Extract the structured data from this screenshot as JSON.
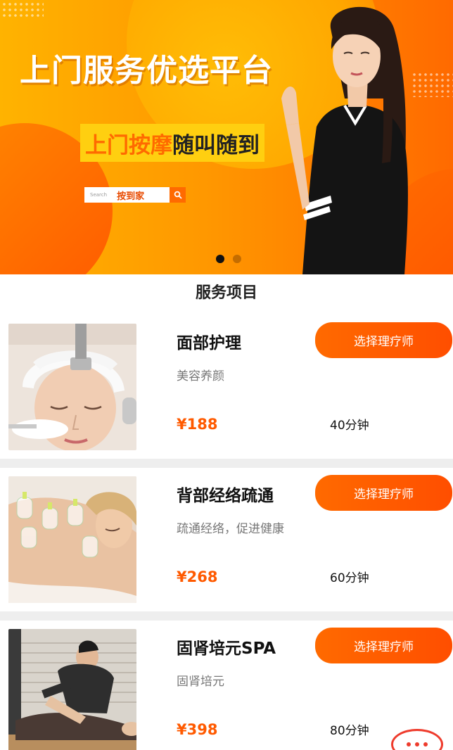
{
  "banner": {
    "title": "上门服务优选平台",
    "slogan_highlight": "上门按摩",
    "slogan_rest": "随叫随到",
    "search_placeholder": "Search",
    "search_brand": "按到家",
    "pager_total": 2,
    "pager_active": 1,
    "accent_color": "#ff6a00"
  },
  "section": {
    "title": "服务项目"
  },
  "services": [
    {
      "name": "面部护理",
      "desc": "美容养颜",
      "price": "¥188",
      "duration": "40分钟",
      "button": "选择理疗师",
      "image": "facial-treatment-photo"
    },
    {
      "name": "背部经络疏通",
      "desc": "疏通经络，促进健康",
      "price": "¥268",
      "duration": "60分钟",
      "button": "选择理疗师",
      "image": "back-cupping-photo"
    },
    {
      "name": "固肾培元SPA",
      "desc": "固肾培元",
      "price": "¥398",
      "duration": "80分钟",
      "button": "选择理疗师",
      "image": "leg-massage-photo"
    }
  ],
  "colors": {
    "price": "#ff5a00",
    "button": "#ff5a00",
    "separator": "#eeeeee"
  },
  "chat_icon": "chat-bubble-icon"
}
